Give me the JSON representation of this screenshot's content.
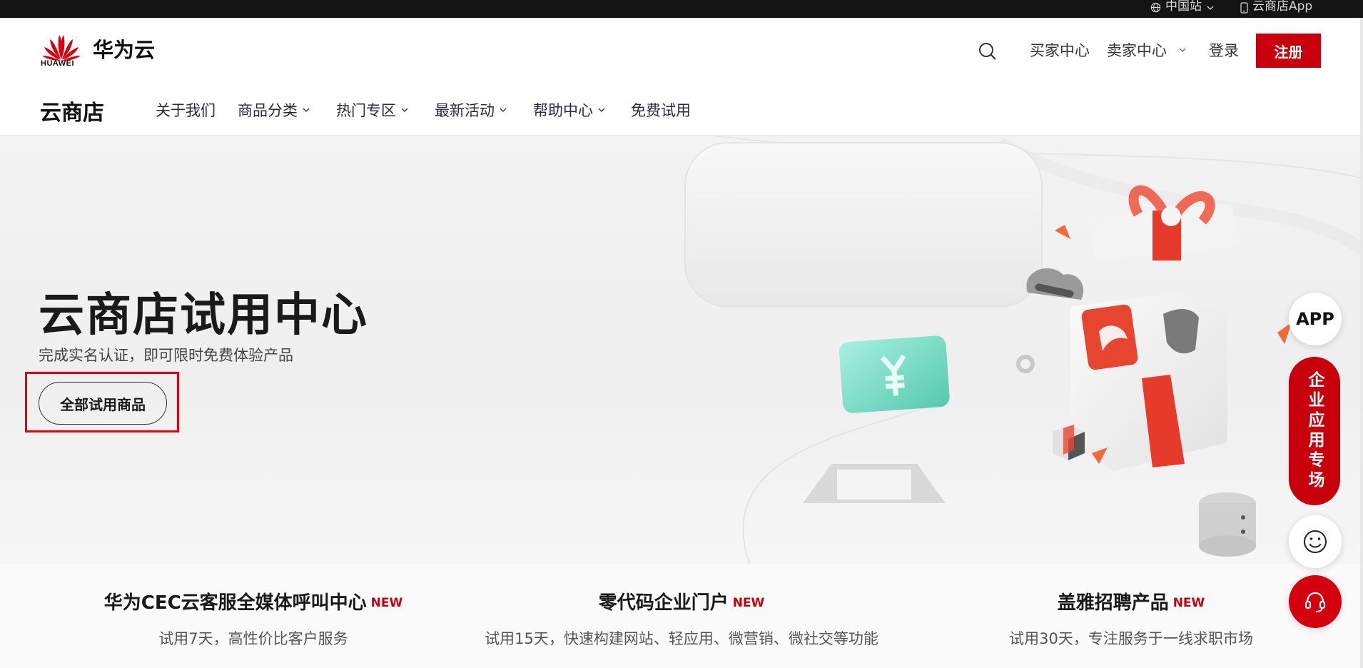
{
  "topbar": {
    "region": "中国站",
    "app": "云商店App"
  },
  "header": {
    "logo_text": "HUAWEI",
    "brand": "华为云",
    "buyer_center": "买家中心",
    "seller_center": "卖家中心",
    "login": "登录",
    "register": "注册"
  },
  "store": {
    "title": "云商店",
    "nav": [
      {
        "label": "关于我们",
        "dropdown": false
      },
      {
        "label": "商品分类",
        "dropdown": true
      },
      {
        "label": "热门专区",
        "dropdown": true
      },
      {
        "label": "最新活动",
        "dropdown": true
      },
      {
        "label": "帮助中心",
        "dropdown": true
      },
      {
        "label": "免费试用",
        "dropdown": false
      }
    ]
  },
  "hero": {
    "title": "云商店试用中心",
    "subtitle": "完成实名认证，即可限时免费体验产品",
    "cta": "全部试用商品"
  },
  "features": [
    {
      "title": "华为CEC云客服全媒体呼叫中心",
      "badge": "NEW",
      "desc": "试用7天，高性价比客户服务"
    },
    {
      "title": "零代码企业门户",
      "badge": "NEW",
      "desc": "试用15天，快速构建网站、轻应用、微营销、微社交等功能"
    },
    {
      "title": "盖雅招聘产品",
      "badge": "NEW",
      "desc": "试用30天，专注服务于一线求职市场"
    }
  ],
  "floating": {
    "app": "APP",
    "enterprise": "企业应用专场"
  },
  "colors": {
    "accent": "#c7000b",
    "topbar": "#141414"
  },
  "icons": [
    "globe-icon",
    "phone-icon",
    "search-icon",
    "chevron-down-icon",
    "smile-icon",
    "headset-icon"
  ]
}
